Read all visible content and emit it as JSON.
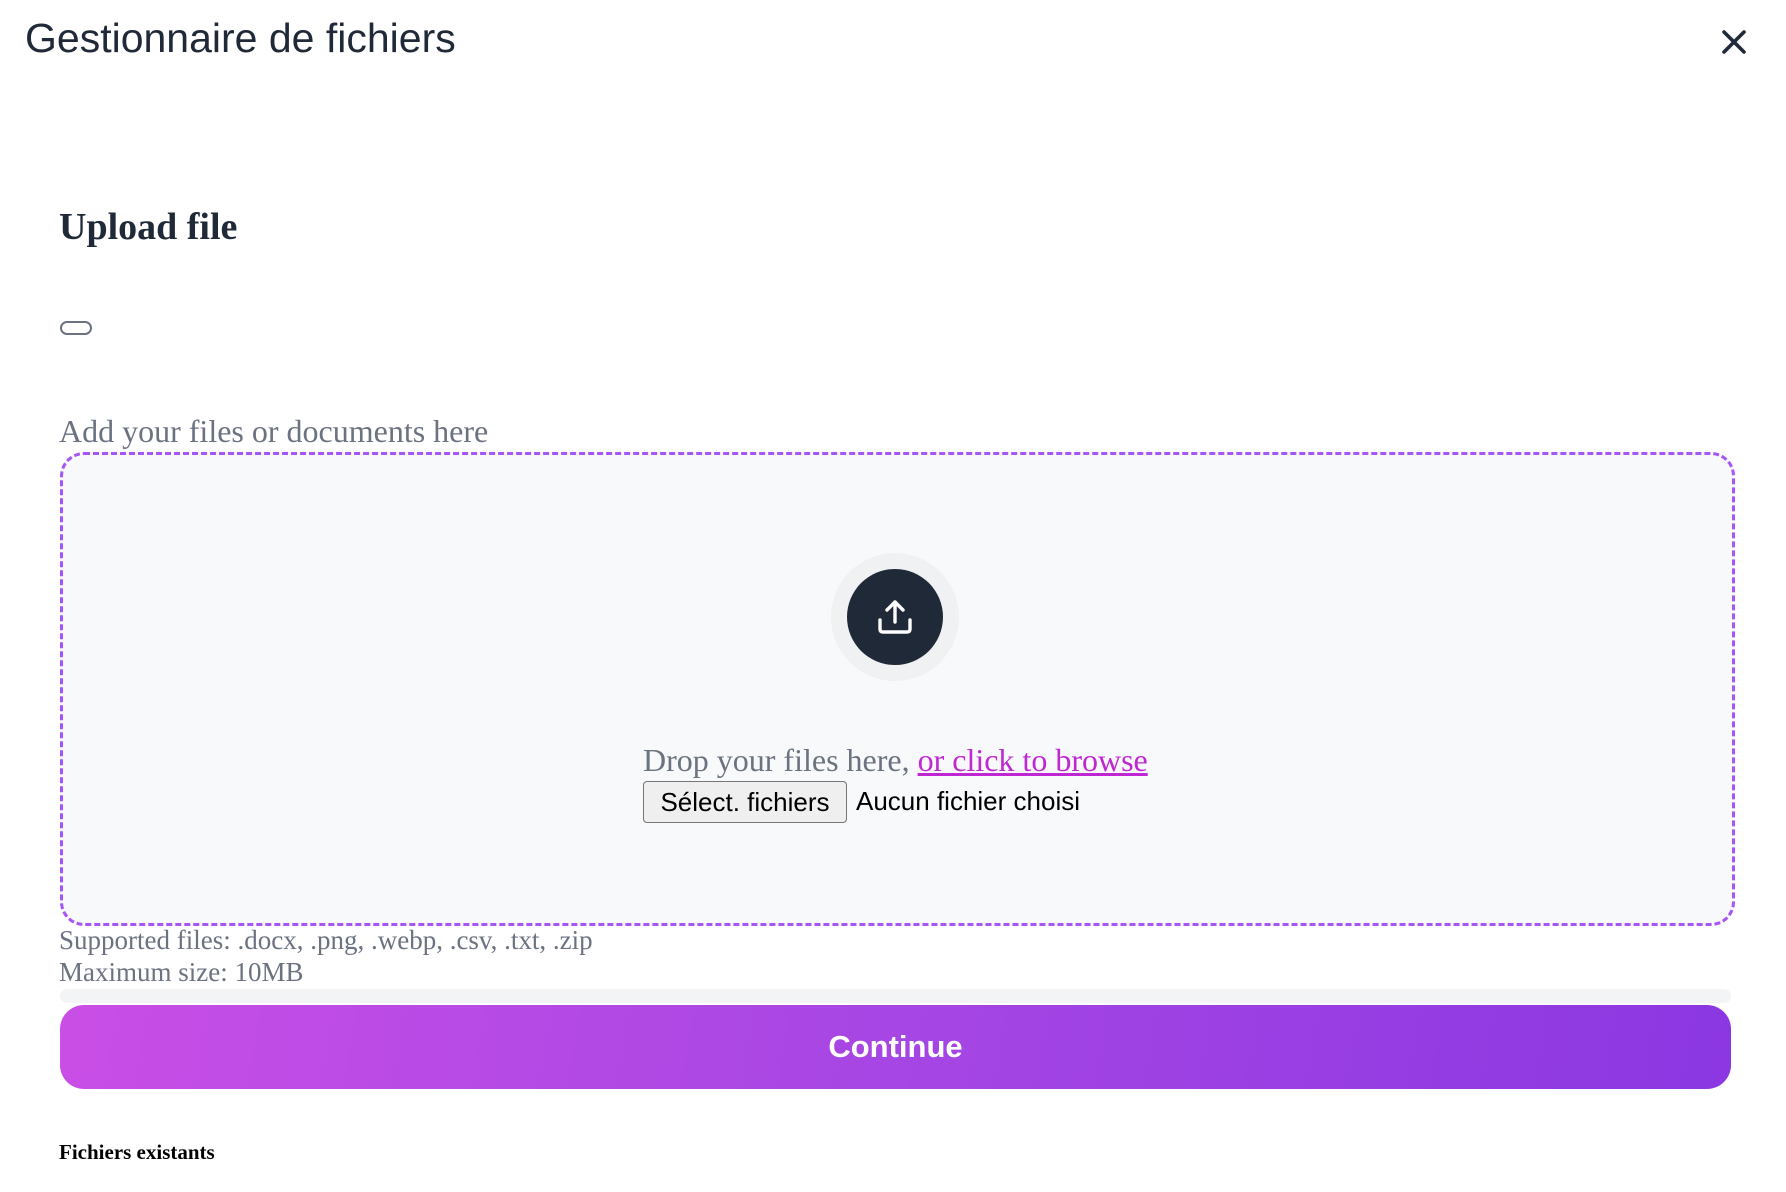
{
  "header": {
    "title": "Gestionnaire de fichiers",
    "close_icon": "close-icon"
  },
  "upload": {
    "title": "Upload file",
    "toggle_state": "off",
    "dropzone_label": "Add your files or documents here",
    "upload_icon": "upload-icon",
    "drop_text": "Drop your files here,",
    "browse_text": "or click to browse",
    "file_input": {
      "button_label": "Sélect. fichiers",
      "status": "Aucun fichier choisi"
    },
    "supported_files": "Supported files: .docx, .png, .webp, .csv, .txt, .zip",
    "max_size": "Maximum size: 10MB",
    "progress": 0,
    "continue_label": "Continue"
  },
  "existing": {
    "title": "Fichiers existants"
  },
  "colors": {
    "accent": "#a855f7",
    "link": "#c026d3",
    "button_gradient_start": "#c94ee6",
    "button_gradient_end": "#8b37e2",
    "text_dark": "#1f2937",
    "text_muted": "#6b7280"
  }
}
